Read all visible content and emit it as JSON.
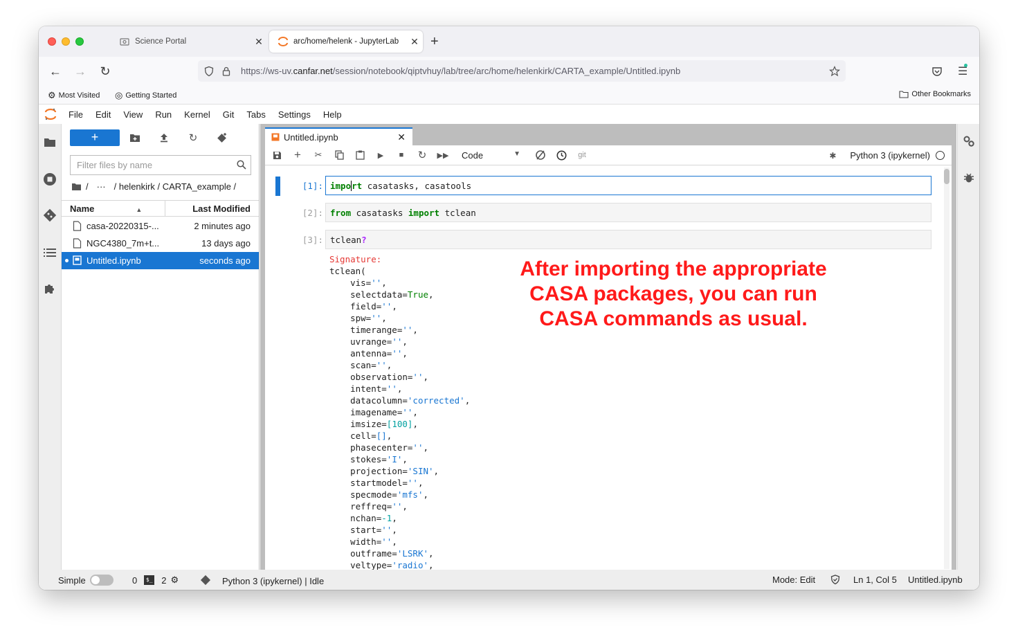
{
  "browser": {
    "tabs": [
      {
        "title": "Science Portal",
        "active": false
      },
      {
        "title": "arc/home/helenk - JupyterLab",
        "active": true
      }
    ],
    "url_prefix": "https://ws-uv.",
    "url_domain": "canfar.net",
    "url_path": "/session/notebook/qiptvhuy/lab/tree/arc/home/helenkirk/CARTA_example/Untitled.ipynb",
    "bookmarks": [
      "Most Visited",
      "Getting Started"
    ],
    "other_bookmarks": "Other Bookmarks"
  },
  "menu": [
    "File",
    "Edit",
    "View",
    "Run",
    "Kernel",
    "Git",
    "Tabs",
    "Settings",
    "Help"
  ],
  "filebrowser": {
    "new_label": "+",
    "filter_placeholder": "Filter files by name",
    "breadcrumb_root": "/",
    "breadcrumb_ellipsis": "···",
    "breadcrumb_path": "/ helenkirk / CARTA_example /",
    "col_name": "Name",
    "col_modified": "Last Modified",
    "files": [
      {
        "name": "casa-20220315-...",
        "modified": "2 minutes ago",
        "selected": false
      },
      {
        "name": "NGC4380_7m+t...",
        "modified": "13 days ago",
        "selected": false
      },
      {
        "name": "Untitled.ipynb",
        "modified": "seconds ago",
        "selected": true
      }
    ]
  },
  "notebook": {
    "tab_title": "Untitled.ipynb",
    "cell_type": "Code",
    "git_label": "git",
    "kernel_name": "Python 3 (ipykernel)",
    "cells": [
      {
        "prompt": "[1]:",
        "active": true
      },
      {
        "prompt": "[2]:",
        "active": false
      },
      {
        "prompt": "[3]:",
        "active": false
      }
    ],
    "annotation": [
      "After importing the appropriate",
      "CASA packages, you can run",
      "CASA commands as usual."
    ]
  },
  "status": {
    "mode_label": "Simple",
    "terminals": "0",
    "kernels": "2",
    "kernel_status": "Python 3 (ipykernel) | Idle",
    "mode": "Mode: Edit",
    "position": "Ln 1, Col 5",
    "filename": "Untitled.ipynb"
  }
}
